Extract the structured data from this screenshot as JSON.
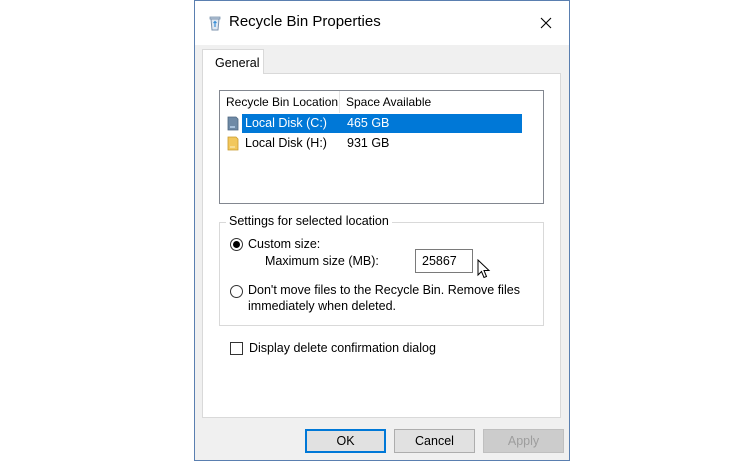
{
  "window": {
    "title": "Recycle Bin Properties",
    "title_icon": "recycle-bin-icon",
    "close_icon": "close-icon"
  },
  "tabs": [
    {
      "label": "General",
      "active": true
    }
  ],
  "locations": {
    "columns": [
      "Recycle Bin Location",
      "Space Available"
    ],
    "rows": [
      {
        "name": "Local Disk (C:)",
        "space": "465 GB",
        "icon": "drive-icon",
        "selected": true
      },
      {
        "name": "Local Disk (H:)",
        "space": "931 GB",
        "icon": "drive-icon",
        "selected": false
      }
    ]
  },
  "settings": {
    "legend": "Settings for selected location",
    "custom_size_label": "Custom size:",
    "max_size_label": "Maximum size (MB):",
    "max_size_value": "25867",
    "custom_size_selected": true,
    "dont_move_label_1": "Don't move files to the Recycle Bin. Remove files",
    "dont_move_label_2": "immediately when deleted.",
    "dont_move_selected": false
  },
  "confirm": {
    "label": "Display delete confirmation dialog",
    "checked": false
  },
  "buttons": {
    "ok": "OK",
    "cancel": "Cancel",
    "apply": "Apply",
    "apply_enabled": false
  },
  "colors": {
    "selection": "#0078d7",
    "window_border": "#5a7fb0"
  }
}
